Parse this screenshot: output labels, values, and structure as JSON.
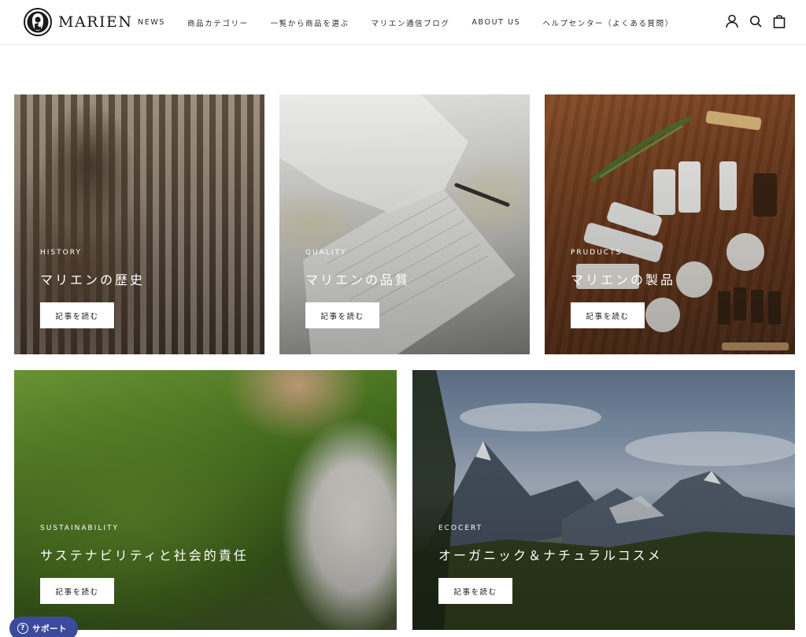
{
  "brand": {
    "name": "MARIEN"
  },
  "nav": {
    "items": [
      {
        "label": "NEWS"
      },
      {
        "label": "商品カテゴリー"
      },
      {
        "label": "一覧から商品を選ぶ"
      },
      {
        "label": "マリエン通信ブログ"
      },
      {
        "label": "ABOUT US"
      },
      {
        "label": "ヘルプセンター（よくある質問）"
      }
    ]
  },
  "header_icons": [
    "account-icon",
    "search-icon",
    "cart-icon"
  ],
  "cards": [
    {
      "eyebrow": "HISTORY",
      "title": "マリエンの歴史",
      "cta": "記事を読む"
    },
    {
      "eyebrow": "QUALITY",
      "title": "マリエンの品質",
      "cta": "記事を読む"
    },
    {
      "eyebrow": "PRUDUCTS",
      "title": "マリエンの製品",
      "cta": "記事を読む"
    },
    {
      "eyebrow": "SUSTAINABILITY",
      "title": "サステナビリティと社会的責任",
      "cta": "記事を読む"
    },
    {
      "eyebrow": "ECOCERT",
      "title": "オーガニック＆ナチュラルコスメ",
      "cta": "記事を読む"
    }
  ],
  "support": {
    "label": "サポート"
  },
  "colors": {
    "support_bg": "#3b4a9a",
    "header_border": "#e6e6e6"
  }
}
